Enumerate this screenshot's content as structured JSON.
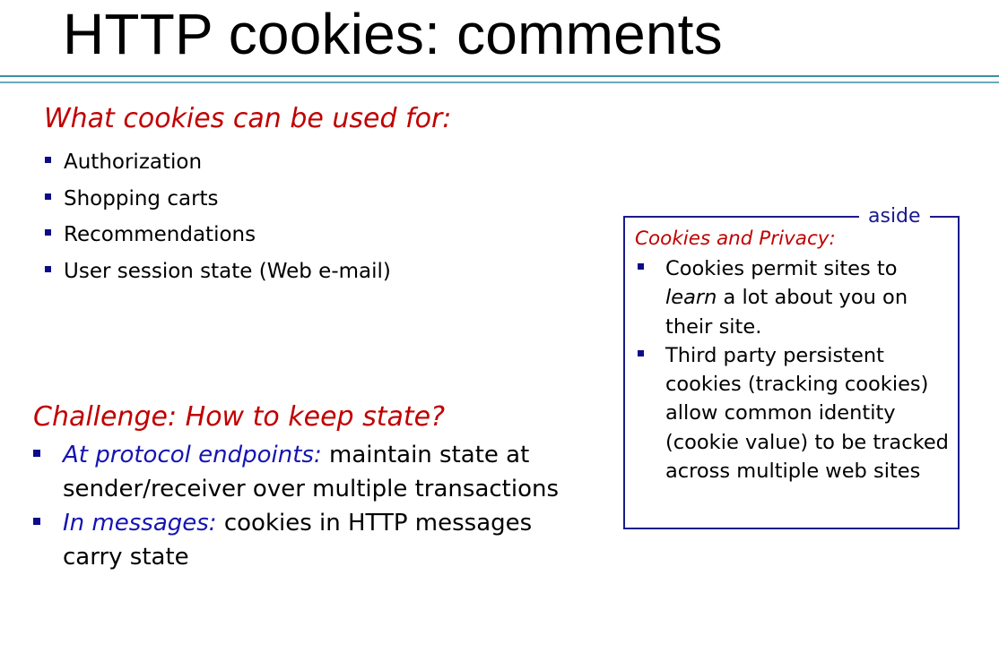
{
  "slide": {
    "title": "HTTP cookies: comments"
  },
  "uses": {
    "heading": "What cookies can be used for:",
    "items": [
      "Authorization",
      "Shopping carts",
      "Recommendations",
      "User session state (Web e-mail)"
    ]
  },
  "challenge": {
    "heading": "Challenge: How to keep state?",
    "items": [
      {
        "emphasis": "At protocol endpoints:",
        "text": " maintain state at sender/receiver over multiple transactions"
      },
      {
        "emphasis": "In messages:",
        "text": " cookies in HTTP messages carry state"
      }
    ]
  },
  "aside": {
    "label": "aside",
    "heading": "Cookies and Privacy:",
    "item1": {
      "before": "Cookies permit sites to ",
      "emphasis": "learn",
      "after": " a lot about you on their site."
    },
    "item2": "Third party persistent cookies (tracking cookies) allow common identity (cookie value) to be tracked across multiple web sites"
  },
  "colors": {
    "heading_red": "#c00000",
    "emphasis_blue": "#1414b4",
    "bullet_navy": "#0c0c8a",
    "rule_teal": "#3d8fa6"
  }
}
